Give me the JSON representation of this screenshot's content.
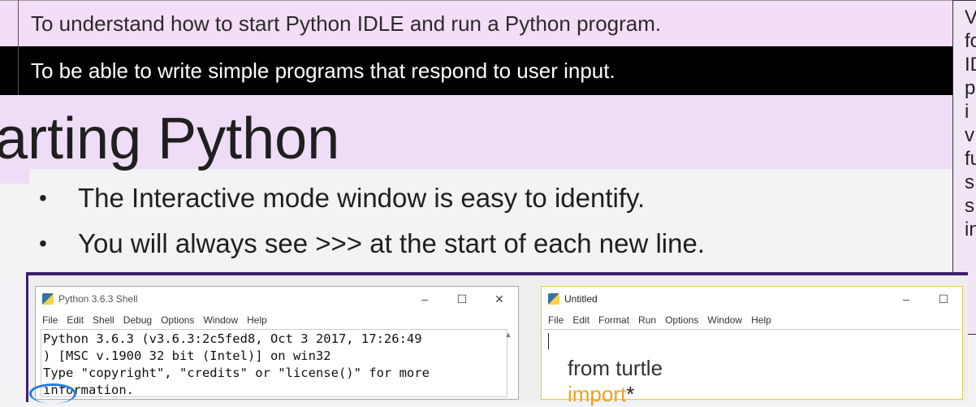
{
  "objectives": [
    "To understand how to start Python IDLE and run a Python program.",
    "To be able to write simple programs that respond to user input."
  ],
  "slide_title": "arting Python",
  "bullets": [
    "The Interactive mode window is easy to identify.",
    "You will always see >>> at the start of each new line."
  ],
  "side_panel_lines": [
    "V",
    "fo",
    "IDL",
    "p",
    " i",
    "v",
    "fu",
    "s",
    "s",
    "in"
  ],
  "shell_window": {
    "title": "Python 3.6.3 Shell",
    "controls": [
      "–",
      "☐",
      "✕"
    ],
    "menu": [
      "File",
      "Edit",
      "Shell",
      "Debug",
      "Options",
      "Window",
      "Help"
    ],
    "lines": [
      "Python 3.6.3 (v3.6.3:2c5fed8, Oct  3 2017, 17:26:49",
      ") [MSC v.1900 32 bit (Intel)] on win32",
      "Type \"copyright\", \"credits\" or \"license()\" for more",
      "information."
    ]
  },
  "editor_window": {
    "title": "Untitled",
    "controls": [
      "–",
      "☐"
    ],
    "menu": [
      "File",
      "Edit",
      "Format",
      "Run",
      "Options",
      "Window",
      "Help"
    ],
    "code_line1": "from turtle",
    "code_keyword": "import",
    "code_suffix": "*"
  },
  "colors": {
    "band": "#efdcf6",
    "frame_border": "#3b1f6e",
    "keyword": "#f0a020"
  }
}
